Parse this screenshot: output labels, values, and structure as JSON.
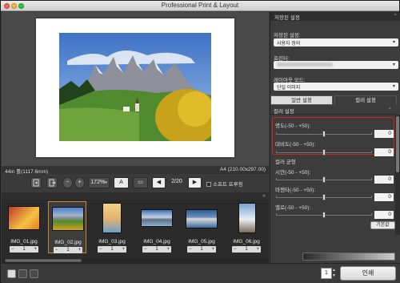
{
  "window": {
    "title": "Professional Print & Layout"
  },
  "paper": {
    "size_left": "44in 롤(1117.6mm)",
    "size_right": "A4 (210.00x297.00)"
  },
  "toolbar": {
    "zoom": "172%",
    "text_button": "A",
    "page_indicator": "2/20",
    "soft_proof": "소프트 프루핑"
  },
  "thumbnails": [
    {
      "name": "IMG_01.jpg",
      "copies": "1",
      "minus": "−",
      "plus": "+"
    },
    {
      "name": "IMG_02.jpg",
      "copies": "1",
      "minus": "−",
      "plus": "+"
    },
    {
      "name": "IMG_03.jpg",
      "copies": "1",
      "minus": "−",
      "plus": "+"
    },
    {
      "name": "IMG_04.jpg",
      "copies": "1",
      "minus": "−",
      "plus": "+"
    },
    {
      "name": "IMG_05.jpg",
      "copies": "1",
      "minus": "−",
      "plus": "+"
    },
    {
      "name": "IMG_06.jpg",
      "copies": "1",
      "minus": "−",
      "plus": "+"
    }
  ],
  "bottom": {
    "copies": "1",
    "print_label": "인쇄"
  },
  "panel": {
    "saved_header": "저장된 설정",
    "saved_label": "저장된 설정:",
    "saved_value": "사용자 정의",
    "printer_label": "프린터:",
    "layout_label": "레이아웃 모드:",
    "layout_value": "단일 이미지",
    "tab_basic": "일반 설정",
    "tab_color": "컬러 설정",
    "color_settings_header": "컬러 설정",
    "brightness_label": "명도(-50 - +50):",
    "brightness_value": "0",
    "contrast_label": "대비도(-50 - +50):",
    "contrast_value": "0",
    "color_balance_header": "컬러 균형",
    "cyan_label": "시안(-50 - +50):",
    "cyan_value": "0",
    "magenta_label": "마젠타(-50 - +50):",
    "magenta_value": "0",
    "yellow_label": "옐로(-50 - +50):",
    "yellow_value": "0",
    "default_button": "기본값"
  },
  "colors": {
    "highlight": "#cc2222",
    "selected_thumb": "#c8842e"
  }
}
